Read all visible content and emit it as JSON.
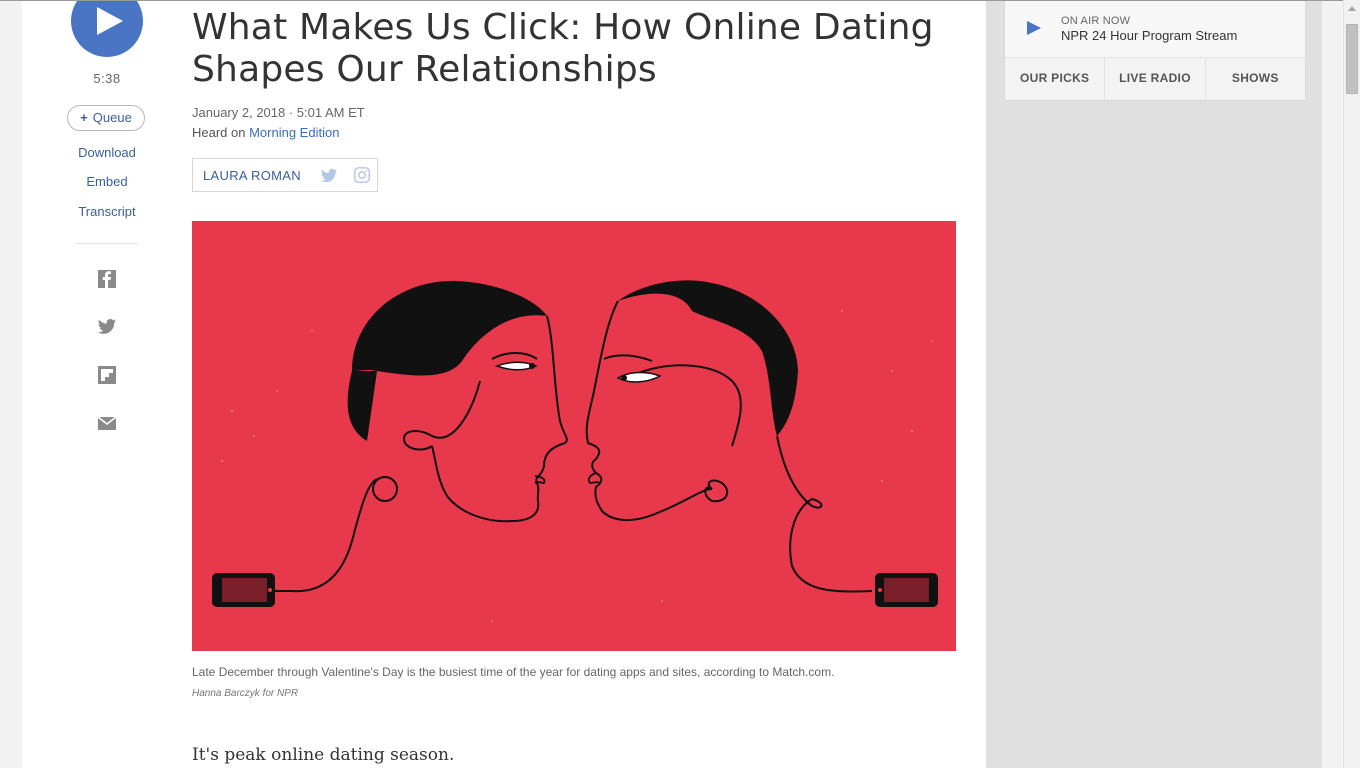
{
  "player": {
    "duration": "5:38",
    "queue_label": "Queue",
    "links": [
      "Download",
      "Embed",
      "Transcript"
    ]
  },
  "share_icons": [
    "facebook-icon",
    "twitter-icon",
    "flipboard-icon",
    "email-icon"
  ],
  "article": {
    "headline": "What Makes Us Click: How Online Dating Shapes Our Relationships",
    "dateline": "January 2, 2018 · 5:01 AM ET",
    "heard_prefix": "Heard on ",
    "program": "Morning Edition",
    "author": "LAURA ROMAN",
    "caption": "Late December through Valentine's Day is the busiest time of the year for dating apps and sites, according to Match.com.",
    "credit": "Hanna Barczyk for NPR",
    "lead": "It's peak online dating season."
  },
  "sidebar": {
    "on_air_label": "ON AIR NOW",
    "stream_title": "NPR 24 Hour Program Stream",
    "nav": [
      "OUR PICKS",
      "LIVE RADIO",
      "SHOWS"
    ]
  },
  "colors": {
    "accent": "#4a74c4",
    "link": "#3a5f9c",
    "hero_bg": "#e8384b"
  }
}
